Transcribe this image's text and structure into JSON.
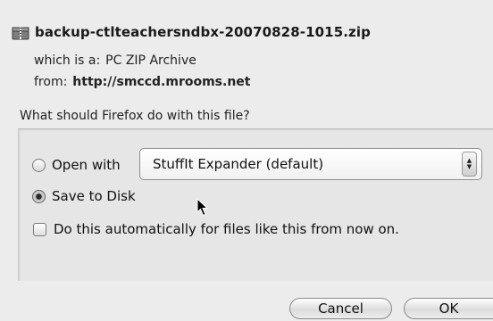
{
  "header": {
    "filename": "backup-ctlteachersndbx-20070828-1015.zip",
    "type_label": "which is a:",
    "type_value": "PC ZIP Archive",
    "from_label": "from:",
    "from_value": "http://smccd.mrooms.net"
  },
  "prompt": "What should Firefox do with this file?",
  "options": {
    "open_with_label": "Open with",
    "open_with_selected": false,
    "app_value": "StuffIt Expander (default)",
    "save_label": "Save to Disk",
    "save_selected": true,
    "auto_label": "Do this automatically for files like this from now on.",
    "auto_checked": false
  },
  "buttons": {
    "cancel_label": "Cancel",
    "ok_label": "OK"
  },
  "icons": {
    "file": "zip-archive-icon",
    "stepper": "up-down-arrows-icon",
    "cursor": "mouse-pointer-icon"
  }
}
